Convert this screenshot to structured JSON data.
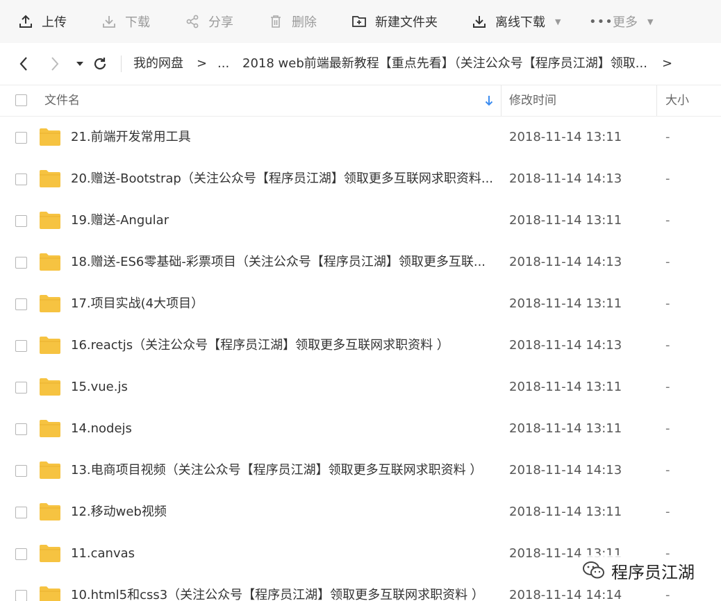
{
  "toolbar": {
    "upload": "上传",
    "download": "下载",
    "share": "分享",
    "delete": "删除",
    "new_folder": "新建文件夹",
    "offline_download": "离线下载",
    "more": "更多"
  },
  "nav": {
    "breadcrumb_root": "我的网盘",
    "breadcrumb_sep1": ">",
    "breadcrumb_ellipsis": "...",
    "breadcrumb_current": "2018 web前端最新教程【重点先看】（关注公众号【程序员江湖】领取...",
    "breadcrumb_sep2": ">"
  },
  "table": {
    "col_name": "文件名",
    "col_modified": "修改时间",
    "col_size": "大小",
    "rows": [
      {
        "name": "21.前端开发常用工具",
        "time": "2018-11-14 13:11",
        "size": "-"
      },
      {
        "name": "20.赠送-Bootstrap（关注公众号【程序员江湖】领取更多互联网求职资料...",
        "time": "2018-11-14 14:13",
        "size": "-"
      },
      {
        "name": "19.赠送-Angular",
        "time": "2018-11-14 13:11",
        "size": "-"
      },
      {
        "name": "18.赠送-ES6零基础-彩票项目（关注公众号【程序员江湖】领取更多互联...",
        "time": "2018-11-14 14:13",
        "size": "-"
      },
      {
        "name": "17.项目实战(4大项目）",
        "time": "2018-11-14 13:11",
        "size": "-"
      },
      {
        "name": "16.reactjs（关注公众号【程序员江湖】领取更多互联网求职资料 ）",
        "time": "2018-11-14 14:13",
        "size": "-"
      },
      {
        "name": "15.vue.js",
        "time": "2018-11-14 13:11",
        "size": "-"
      },
      {
        "name": "14.nodejs",
        "time": "2018-11-14 13:11",
        "size": "-"
      },
      {
        "name": "13.电商项目视频（关注公众号【程序员江湖】领取更多互联网求职资料 ）",
        "time": "2018-11-14 14:13",
        "size": "-"
      },
      {
        "name": "12.移动web视频",
        "time": "2018-11-14 13:11",
        "size": "-"
      },
      {
        "name": "11.canvas",
        "time": "2018-11-14 13:11",
        "size": "-"
      },
      {
        "name": "10.html5和css3（关注公众号【程序员江湖】领取更多互联网求职资料 ）",
        "time": "2018-11-14 14:14",
        "size": "-"
      }
    ]
  },
  "watermark": "程序员江湖",
  "colors": {
    "folder": "#f6c341",
    "accent": "#3b8cf0"
  }
}
